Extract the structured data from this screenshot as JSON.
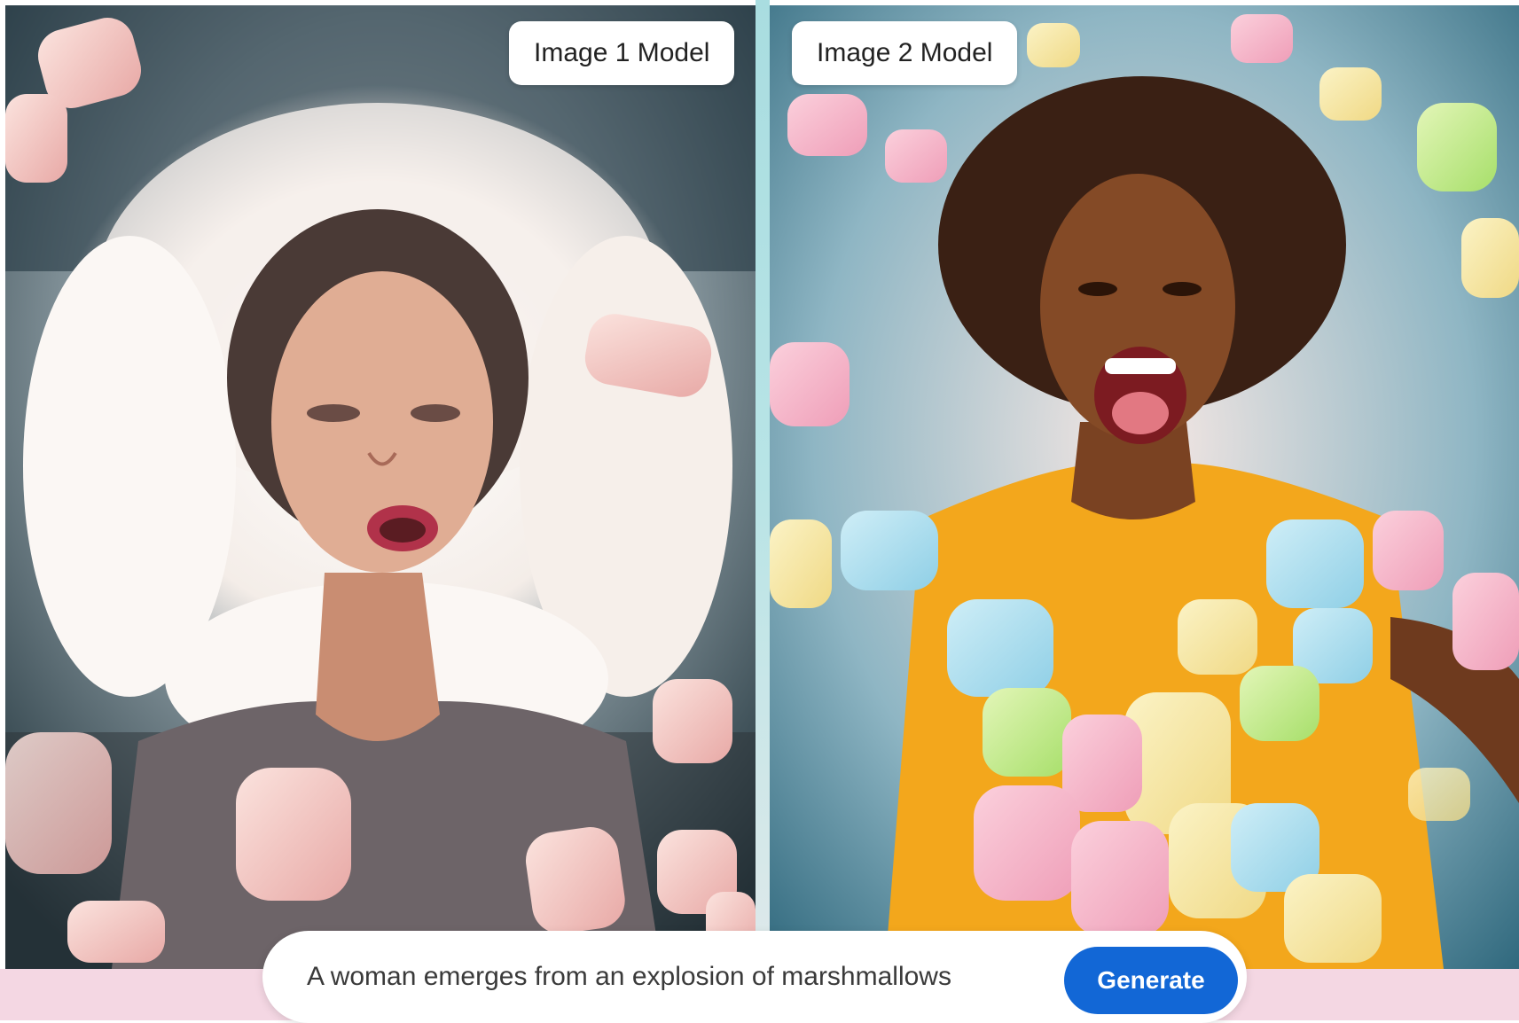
{
  "panels": [
    {
      "label": "Image 1 Model",
      "image": "generated-image-woman-white-marshmallow-cloud"
    },
    {
      "label": "Image 2 Model",
      "image": "generated-image-woman-colorful-marshmallows"
    }
  ],
  "prompt": {
    "text": "A woman emerges from an explosion of marshmallows",
    "generate_label": "Generate"
  },
  "colors": {
    "generate_button": "#1267d6",
    "footer_strip": "#f4d7e3",
    "divider": "#a9dde0"
  }
}
